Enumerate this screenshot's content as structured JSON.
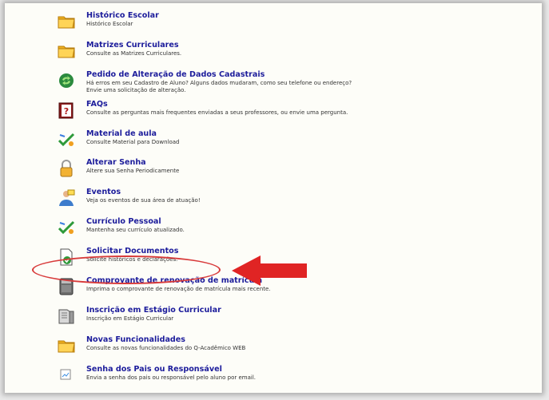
{
  "menu": {
    "items": [
      {
        "title": "Histórico Escolar",
        "description": "Histórico Escolar",
        "icon": "folder-icon"
      },
      {
        "title": "Matrizes Curriculares",
        "description": "Consulte as Matrizes Curriculares.",
        "icon": "folder-icon"
      },
      {
        "title": "Pedido de Alteração de Dados Cadastrais",
        "description": "Há erros em seu Cadastro de Aluno? Alguns dados mudaram, como seu telefone ou endereço? Envie uma solicitação de alteração.",
        "icon": "recycle-icon"
      },
      {
        "title": "FAQs",
        "description": "Consulte as perguntas mais frequentes enviadas a seus professores, ou envie uma pergunta.",
        "icon": "help-book-icon"
      },
      {
        "title": "Material de aula",
        "description": "Consulte Material para Download",
        "icon": "download-check-icon"
      },
      {
        "title": "Alterar Senha",
        "description": "Altere sua Senha Periodicamente",
        "icon": "lock-icon"
      },
      {
        "title": "Eventos",
        "description": "Veja os eventos de sua área de atuação!",
        "icon": "person-event-icon"
      },
      {
        "title": "Currículo Pessoal",
        "description": "Mantenha seu currículo atualizado.",
        "icon": "download-check-icon"
      },
      {
        "title": "Solicitar Documentos",
        "description": "Solicite históricos e declarações.",
        "icon": "document-request-icon"
      },
      {
        "title": "Comprovante de renovação de matrícula",
        "description": "Imprima o comprovante de renovação de matrícula mais recente.",
        "icon": "printer-icon"
      },
      {
        "title": "Inscrição em Estágio Curricular",
        "description": "Inscrição em Estágio Curricular",
        "icon": "book-icon"
      },
      {
        "title": "Novas Funcionalidades",
        "description": "Consulte as novas funcionalidades do Q-Acadêmico WEB",
        "icon": "folder-icon"
      },
      {
        "title": "Senha dos Pais ou Responsável",
        "description": "Envia a senha dos pais ou responsável pelo aluno por email.",
        "icon": "broken-image-icon"
      }
    ]
  },
  "annotation": {
    "highlight_color": "#d83a3a",
    "arrow_color": "#e02424"
  },
  "colors": {
    "link": "#1c1c9b",
    "background": "#fdfdf8"
  }
}
